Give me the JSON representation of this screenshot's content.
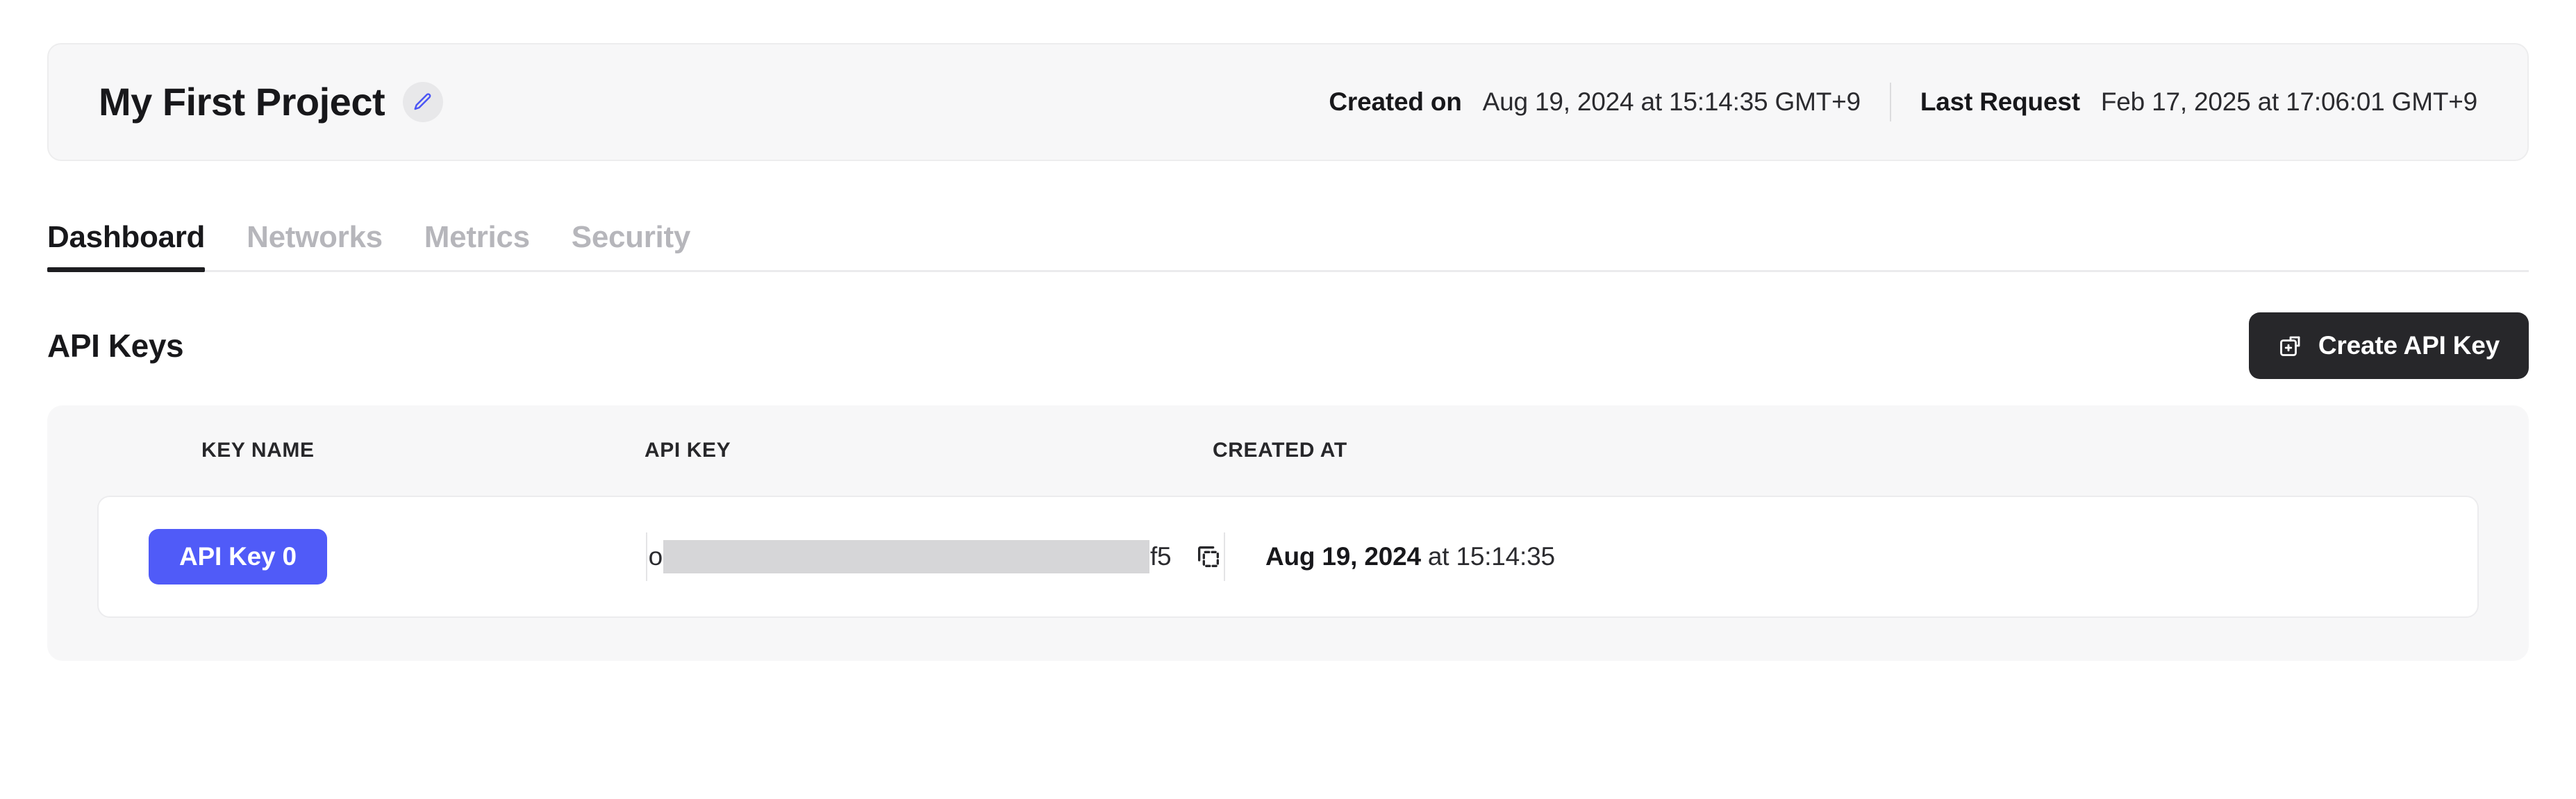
{
  "project": {
    "name": "My First Project",
    "edit_icon": "pencil-icon",
    "created_on_label": "Created on",
    "created_on_value": "Aug 19, 2024 at 15:14:35 GMT+9",
    "last_request_label": "Last Request",
    "last_request_value": "Feb 17, 2025 at 17:06:01 GMT+9"
  },
  "tabs": [
    {
      "label": "Dashboard",
      "active": true
    },
    {
      "label": "Networks",
      "active": false
    },
    {
      "label": "Metrics",
      "active": false
    },
    {
      "label": "Security",
      "active": false
    }
  ],
  "api_keys_section": {
    "title": "API Keys",
    "create_button": {
      "label": "Create API Key",
      "icon": "copy-plus-icon"
    },
    "columns": [
      "KEY NAME",
      "API KEY",
      "CREATED AT"
    ],
    "rows": [
      {
        "key_name": "API Key 0",
        "api_key_prefix": "o",
        "api_key_masked": true,
        "api_key_suffix": "f5",
        "copy_icon": "copy-icon",
        "created_at_date": "Aug 19, 2024",
        "created_at_time": " at 15:14:35"
      }
    ]
  },
  "colors": {
    "accent_blue": "#505bf8",
    "button_dark": "#27272a",
    "card_grey": "#f7f7f8",
    "redacted_grey": "#d6d6d8",
    "muted_text": "#b6b6bb"
  }
}
